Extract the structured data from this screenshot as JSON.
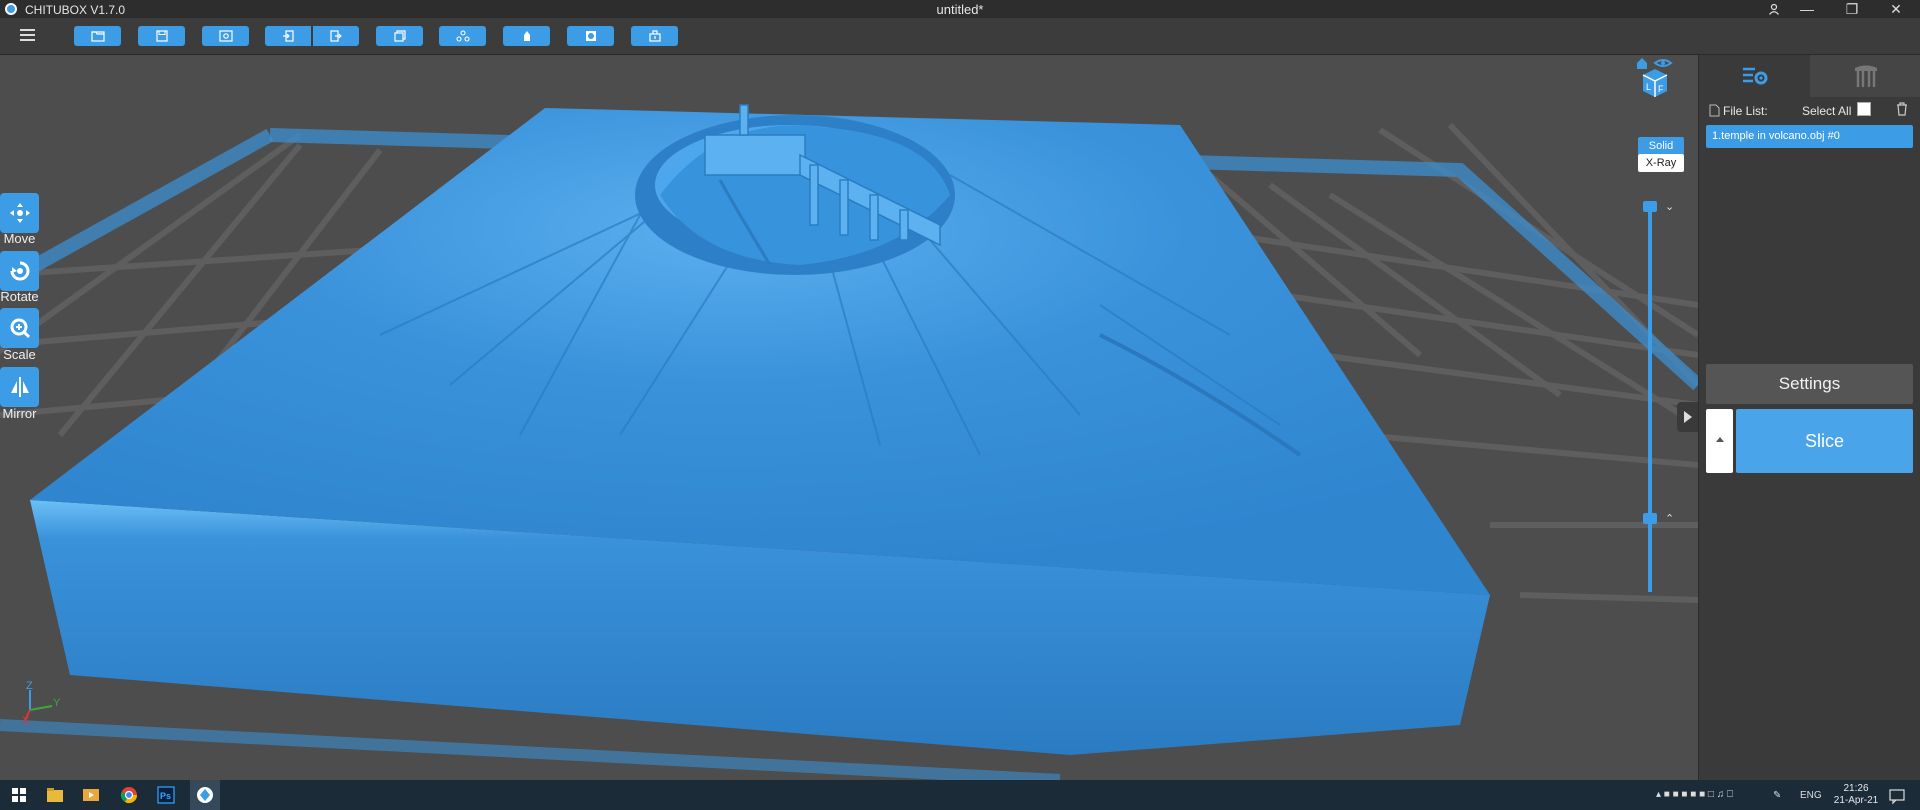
{
  "titlebar": {
    "app_name": "CHITUBOX V1.7.0",
    "doc_title": "untitled*"
  },
  "toolbar": {
    "buttons": [
      "open-file-icon",
      "save-icon",
      "screenshot-icon",
      "import-icon",
      "export-icon",
      "copy-icon",
      "layout-icon",
      "support-icon",
      "hollow-icon",
      "drill-icon"
    ]
  },
  "tools": {
    "move": "Move",
    "rotate": "Rotate",
    "scale": "Scale",
    "mirror": "Mirror"
  },
  "view_modes": {
    "solid": "Solid",
    "xray": "X-Ray"
  },
  "axes": {
    "z": "Z",
    "y": "Y",
    "x": "X"
  },
  "panel": {
    "file_list_label": "File List:",
    "select_all_label": "Select All",
    "files": [
      "1.temple in volcano.obj #0"
    ],
    "settings_label": "Settings",
    "slice_label": "Slice"
  },
  "taskbar": {
    "language": "ENG",
    "time": "21:26",
    "date": "21-Apr-21"
  },
  "colors": {
    "accent": "#3c9ce6",
    "model": "#3a8fd6",
    "background": "#4d4d4d"
  }
}
